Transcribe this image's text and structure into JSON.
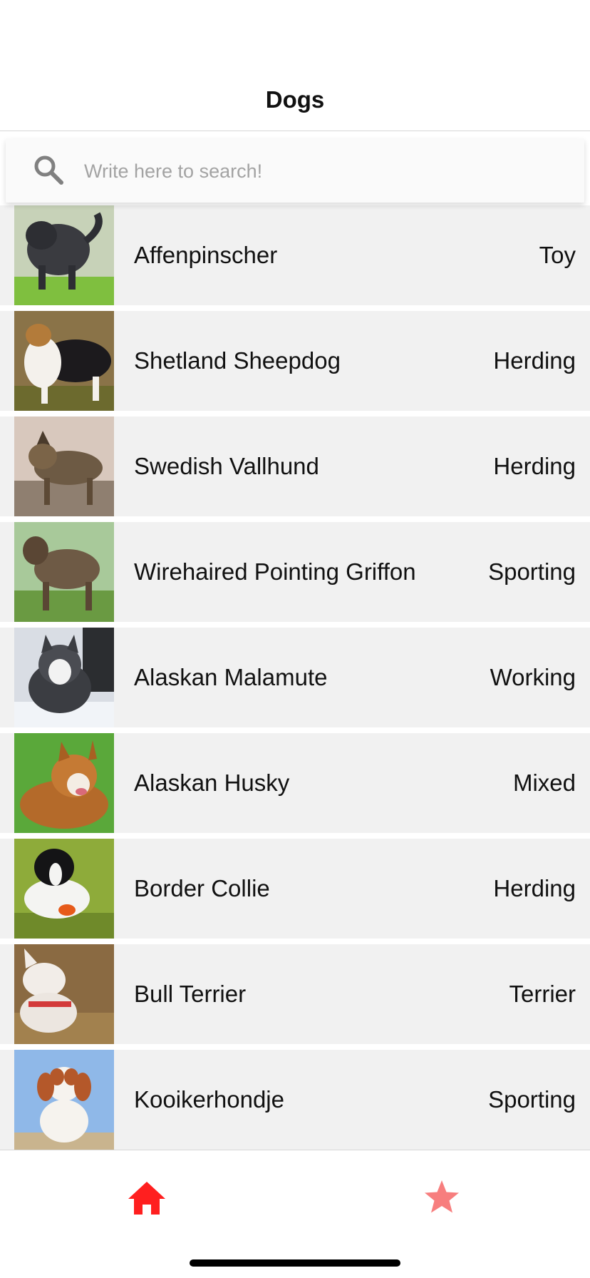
{
  "header": {
    "title": "Dogs"
  },
  "search": {
    "placeholder": "Write here to search!",
    "value": "",
    "icon": "search-icon"
  },
  "dogs": [
    {
      "name": "Affenpinscher",
      "group": "Toy"
    },
    {
      "name": "Shetland Sheepdog",
      "group": "Herding"
    },
    {
      "name": "Swedish Vallhund",
      "group": "Herding"
    },
    {
      "name": "Wirehaired Pointing Griffon",
      "group": "Sporting"
    },
    {
      "name": "Alaskan Malamute",
      "group": "Working"
    },
    {
      "name": "Alaskan Husky",
      "group": "Mixed"
    },
    {
      "name": "Border Collie",
      "group": "Herding"
    },
    {
      "name": "Bull Terrier",
      "group": "Terrier"
    },
    {
      "name": "Kooikerhondje",
      "group": "Sporting"
    }
  ],
  "tabs": [
    {
      "icon": "home-icon",
      "active": true
    },
    {
      "icon": "star-icon",
      "active": false
    }
  ],
  "colors": {
    "accent_active": "#ff1f1f",
    "accent_inactive": "#f77e7e",
    "row_background": "#f1f1f1"
  }
}
